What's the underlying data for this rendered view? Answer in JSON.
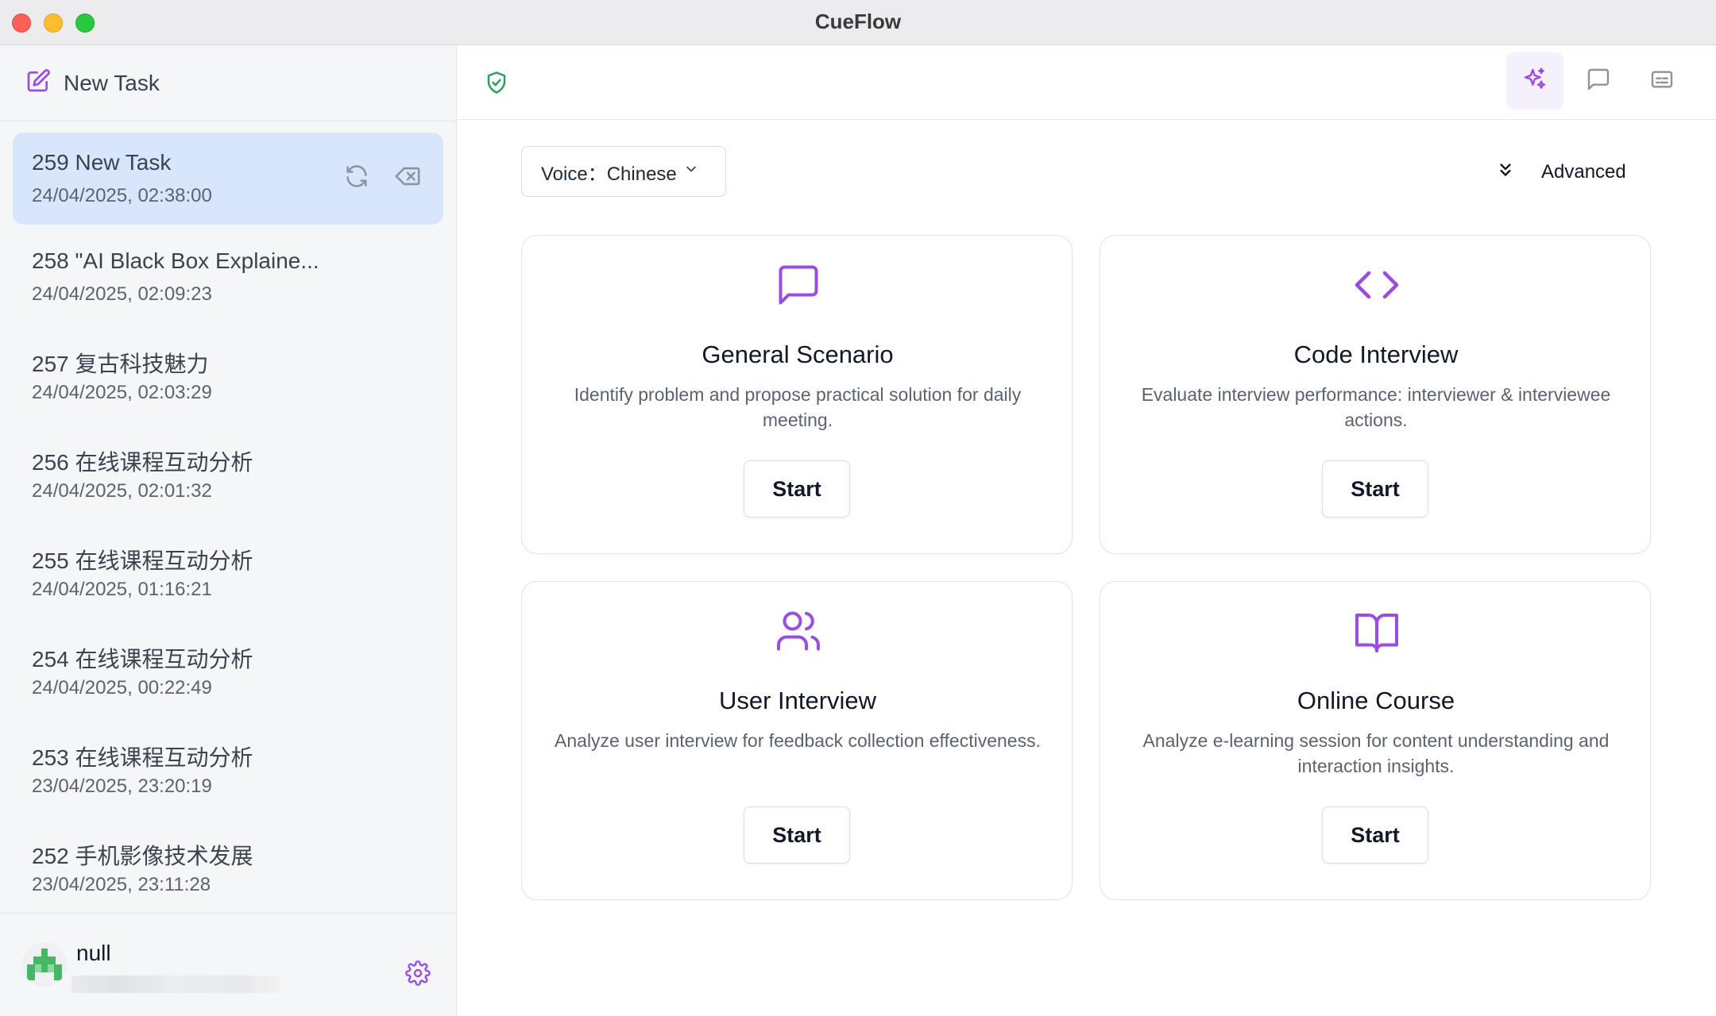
{
  "window": {
    "title": "CueFlow"
  },
  "sidebar": {
    "new_task_label": "New Task",
    "tasks": [
      {
        "title": "259 New Task",
        "date": "24/04/2025, 02:38:00",
        "selected": true
      },
      {
        "title": "258 \"AI Black Box Explaine...",
        "date": "24/04/2025, 02:09:23"
      },
      {
        "title": "257 复古科技魅力",
        "date": "24/04/2025, 02:03:29"
      },
      {
        "title": "256 在线课程互动分析",
        "date": "24/04/2025, 02:01:32"
      },
      {
        "title": "255 在线课程互动分析",
        "date": "24/04/2025, 01:16:21"
      },
      {
        "title": "254 在线课程互动分析",
        "date": "24/04/2025, 00:22:49"
      },
      {
        "title": "253 在线课程互动分析",
        "date": "23/04/2025, 23:20:19"
      },
      {
        "title": "252 手机影像技术发展",
        "date": "23/04/2025, 23:11:28"
      }
    ],
    "user": {
      "name": "null"
    }
  },
  "main": {
    "voice_select": {
      "label": "Voice：Chinese"
    },
    "advanced_label": "Advanced",
    "cards": [
      {
        "icon": "chat-bubble-icon",
        "title": "General Scenario",
        "description": "Identify problem and propose practical solution for daily meeting.",
        "button": "Start"
      },
      {
        "icon": "code-icon",
        "title": "Code Interview",
        "description": "Evaluate interview performance: interviewer & interviewee actions.",
        "button": "Start"
      },
      {
        "icon": "users-icon",
        "title": "User Interview",
        "description": "Analyze user interview for feedback collection effectiveness.",
        "button": "Start"
      },
      {
        "icon": "book-open-icon",
        "title": "Online Course",
        "description": "Analyze e-learning session for content understanding and interaction insights.",
        "button": "Start"
      }
    ]
  },
  "colors": {
    "accent": "#9b4de3",
    "selected_bg": "#d8e6fb",
    "shield": "#22a55a"
  }
}
